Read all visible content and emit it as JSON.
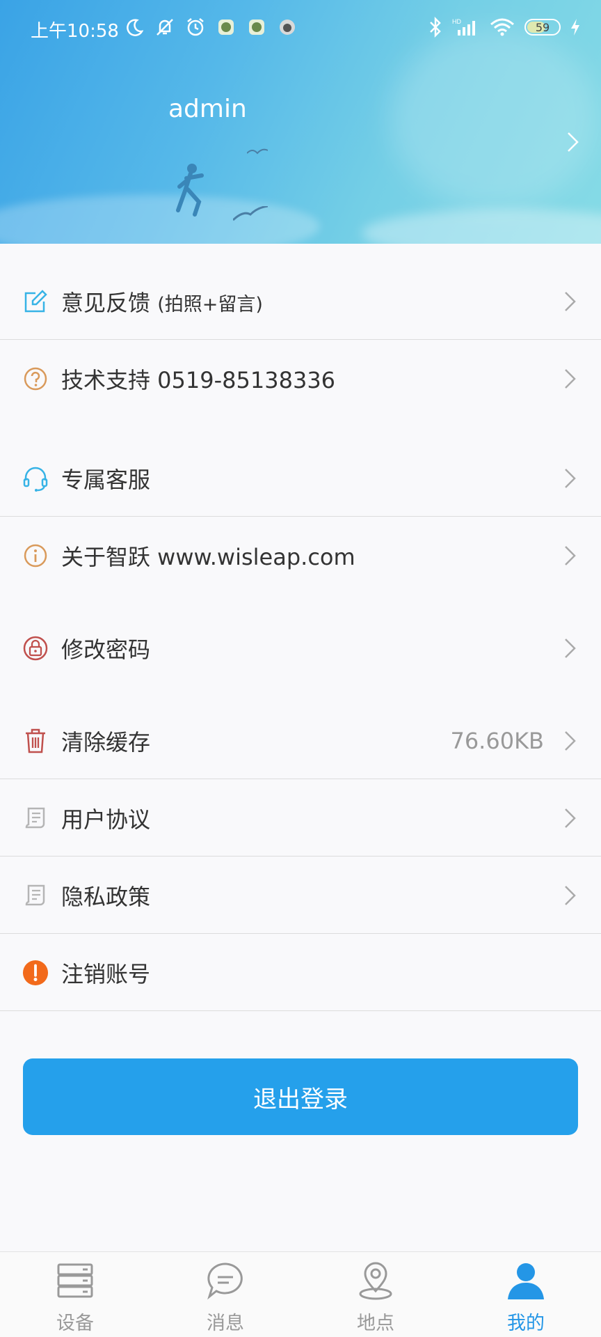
{
  "status_bar": {
    "time": "上午10:58",
    "battery": "59"
  },
  "profile": {
    "username": "admin"
  },
  "menu": {
    "feedback_label": "意见反馈",
    "feedback_sub": "(拍照+留言)",
    "support_label": "技术支持 0519-85138336",
    "service_label": "专属客服",
    "about_label": "关于智跃 www.wisleap.com",
    "password_label": "修改密码",
    "cache_label": "清除缓存",
    "cache_value": "76.60KB",
    "agreement_label": "用户协议",
    "privacy_label": "隐私政策",
    "deregister_label": "注销账号"
  },
  "logout_label": "退出登录",
  "tabs": {
    "devices": "设备",
    "messages": "消息",
    "places": "地点",
    "mine": "我的",
    "active": "我的"
  },
  "colors": {
    "accent": "#25a0eb",
    "warning": "#f26a1b",
    "header_start": "#3aa3e6",
    "header_end": "#86dbe6"
  }
}
